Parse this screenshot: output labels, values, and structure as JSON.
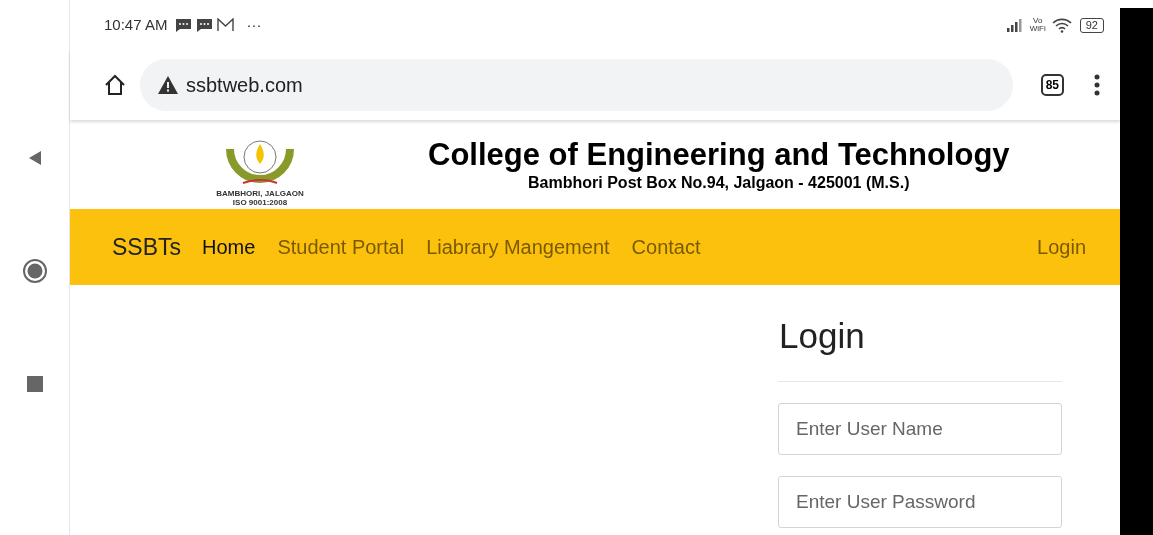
{
  "status_bar": {
    "time": "10:47 AM",
    "more": "···",
    "battery": "92",
    "network": "Vo WiFi"
  },
  "browser": {
    "url": "ssbtweb.com",
    "tab_count": "85"
  },
  "header": {
    "logo_lines": [
      "BAMBHORI, JALGAON",
      "ISO 9001:2008"
    ],
    "title": "College of Engineering and Technology",
    "address": "Bambhori Post Box No.94, Jalgaon - 425001 (M.S.)"
  },
  "navbar": {
    "brand": "SSBTs",
    "items": [
      {
        "label": "Home",
        "selected": true
      },
      {
        "label": "Student Portal",
        "selected": false
      },
      {
        "label": "Liabrary Mangement",
        "selected": false
      },
      {
        "label": "Contact",
        "selected": false
      }
    ],
    "login": "Login"
  },
  "login_form": {
    "title": "Login",
    "fields": [
      {
        "placeholder": "Enter User Name"
      },
      {
        "placeholder": "Enter User Password"
      }
    ]
  }
}
